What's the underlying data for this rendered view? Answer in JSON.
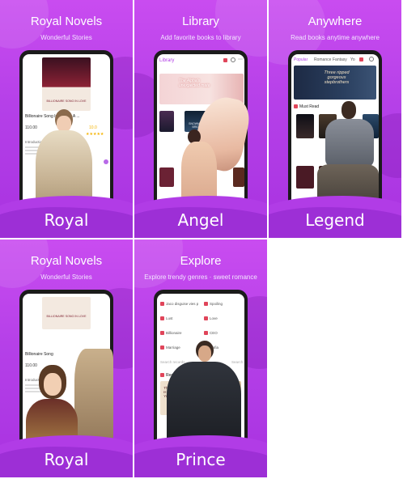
{
  "panels": [
    {
      "title": "Royal Novels",
      "subtitle": "Wonderful Stories",
      "bottom_word": "Royal",
      "book_cover_text": "BILLIONAIRE SONG IN LOVE",
      "book_title": "Billionaire Song In Love Is A ...",
      "price": "110.00",
      "rating_value": "10.0",
      "intro_label": "Introduction"
    },
    {
      "title": "Library",
      "subtitle": "Add favorite books to library",
      "bottom_word": "Angel",
      "app_header": "Library",
      "banner_text": "The Alpha's unexpected mate",
      "cover_text": "SNOWMOON BRIDES"
    },
    {
      "title": "Anywhere",
      "subtitle": "Read books anytime anywhere",
      "bottom_word": "Legend",
      "tabs": [
        "Popular",
        "Romance",
        "Fantasy",
        "Yo"
      ],
      "banner_text": "Three ripped gorgeous stepbrothers",
      "section": "Must Read"
    },
    {
      "title": "Royal Novels",
      "subtitle": "Wonderful Stories",
      "bottom_word": "Royal",
      "book_cover_text": "BILLIONAIRE SONG IN LOVE",
      "book_title": "Billionaire Song",
      "price": "110.00",
      "intro_label": "Introduction",
      "update_text": "Update: 2021",
      "read_btn": "Reading"
    },
    {
      "title": "Explore",
      "subtitle": "Explore trendy genres · sweet romance",
      "bottom_word": "Prince",
      "genres": [
        [
          "Jaco disguise vies p",
          "Spoiling"
        ],
        [
          "Lust",
          "Love"
        ],
        [
          "Billionaire",
          "CEO"
        ],
        [
          "Marriage",
          "Mafia"
        ]
      ],
      "search_placeholder": "Search records",
      "search_link": "Search",
      "section": "Recommend",
      "banner_text": "The Marriage Is Not Up To You"
    }
  ],
  "colors": {
    "tile_top": "#c94cf0",
    "tile_bottom": "#a832e0",
    "wave": "#b13ce6",
    "accent_red": "#e0455a",
    "star": "#f5b301"
  }
}
